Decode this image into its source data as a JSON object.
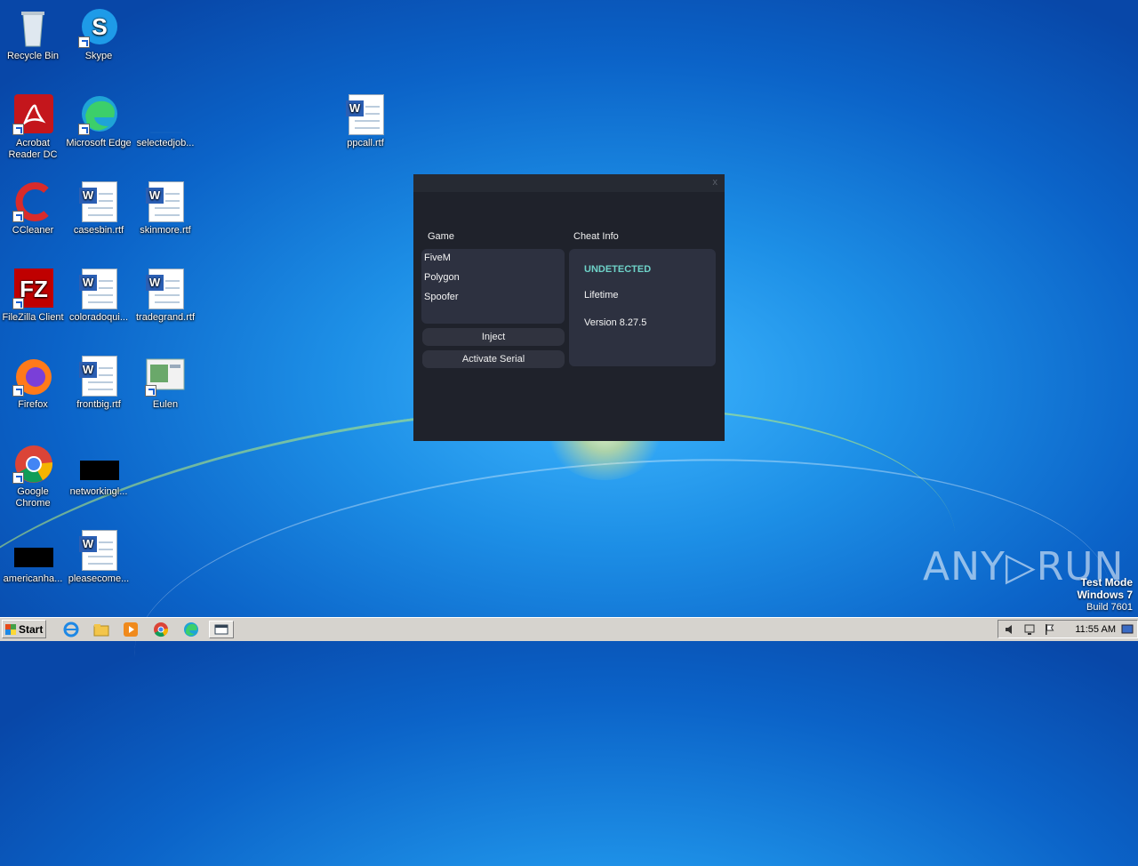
{
  "desktop": {
    "icons": [
      {
        "label": "Recycle Bin"
      },
      {
        "label": "Skype"
      },
      {
        "label": "Acrobat Reader DC"
      },
      {
        "label": "Microsoft Edge"
      },
      {
        "label": "selectedjob..."
      },
      {
        "label": "ppcall.rtf"
      },
      {
        "label": "CCleaner"
      },
      {
        "label": "casesbin.rtf"
      },
      {
        "label": "skinmore.rtf"
      },
      {
        "label": "FileZilla Client"
      },
      {
        "label": "coloradoqui..."
      },
      {
        "label": "tradegrand.rtf"
      },
      {
        "label": "Firefox"
      },
      {
        "label": "frontbig.rtf"
      },
      {
        "label": "Eulen"
      },
      {
        "label": "Google Chrome"
      },
      {
        "label": "networkingl..."
      },
      {
        "label": "americanha..."
      },
      {
        "label": "pleasecome..."
      }
    ]
  },
  "app": {
    "close_label": "x",
    "game_title": "Game",
    "games": [
      "FiveM",
      "Polygon",
      "Spoofer"
    ],
    "inject_label": "Inject",
    "activate_label": "Activate Serial",
    "info_title": "Cheat Info",
    "status": "UNDETECTED",
    "license": "Lifetime",
    "version": "Version 8.27.5",
    "status_color": "#6ed2c8"
  },
  "watermark": {
    "brand": "ANY▷RUN",
    "mode": "Test Mode",
    "os": "Windows 7",
    "build": "Build 7601"
  },
  "taskbar": {
    "start_label": "Start",
    "clock": "11:55 AM"
  }
}
